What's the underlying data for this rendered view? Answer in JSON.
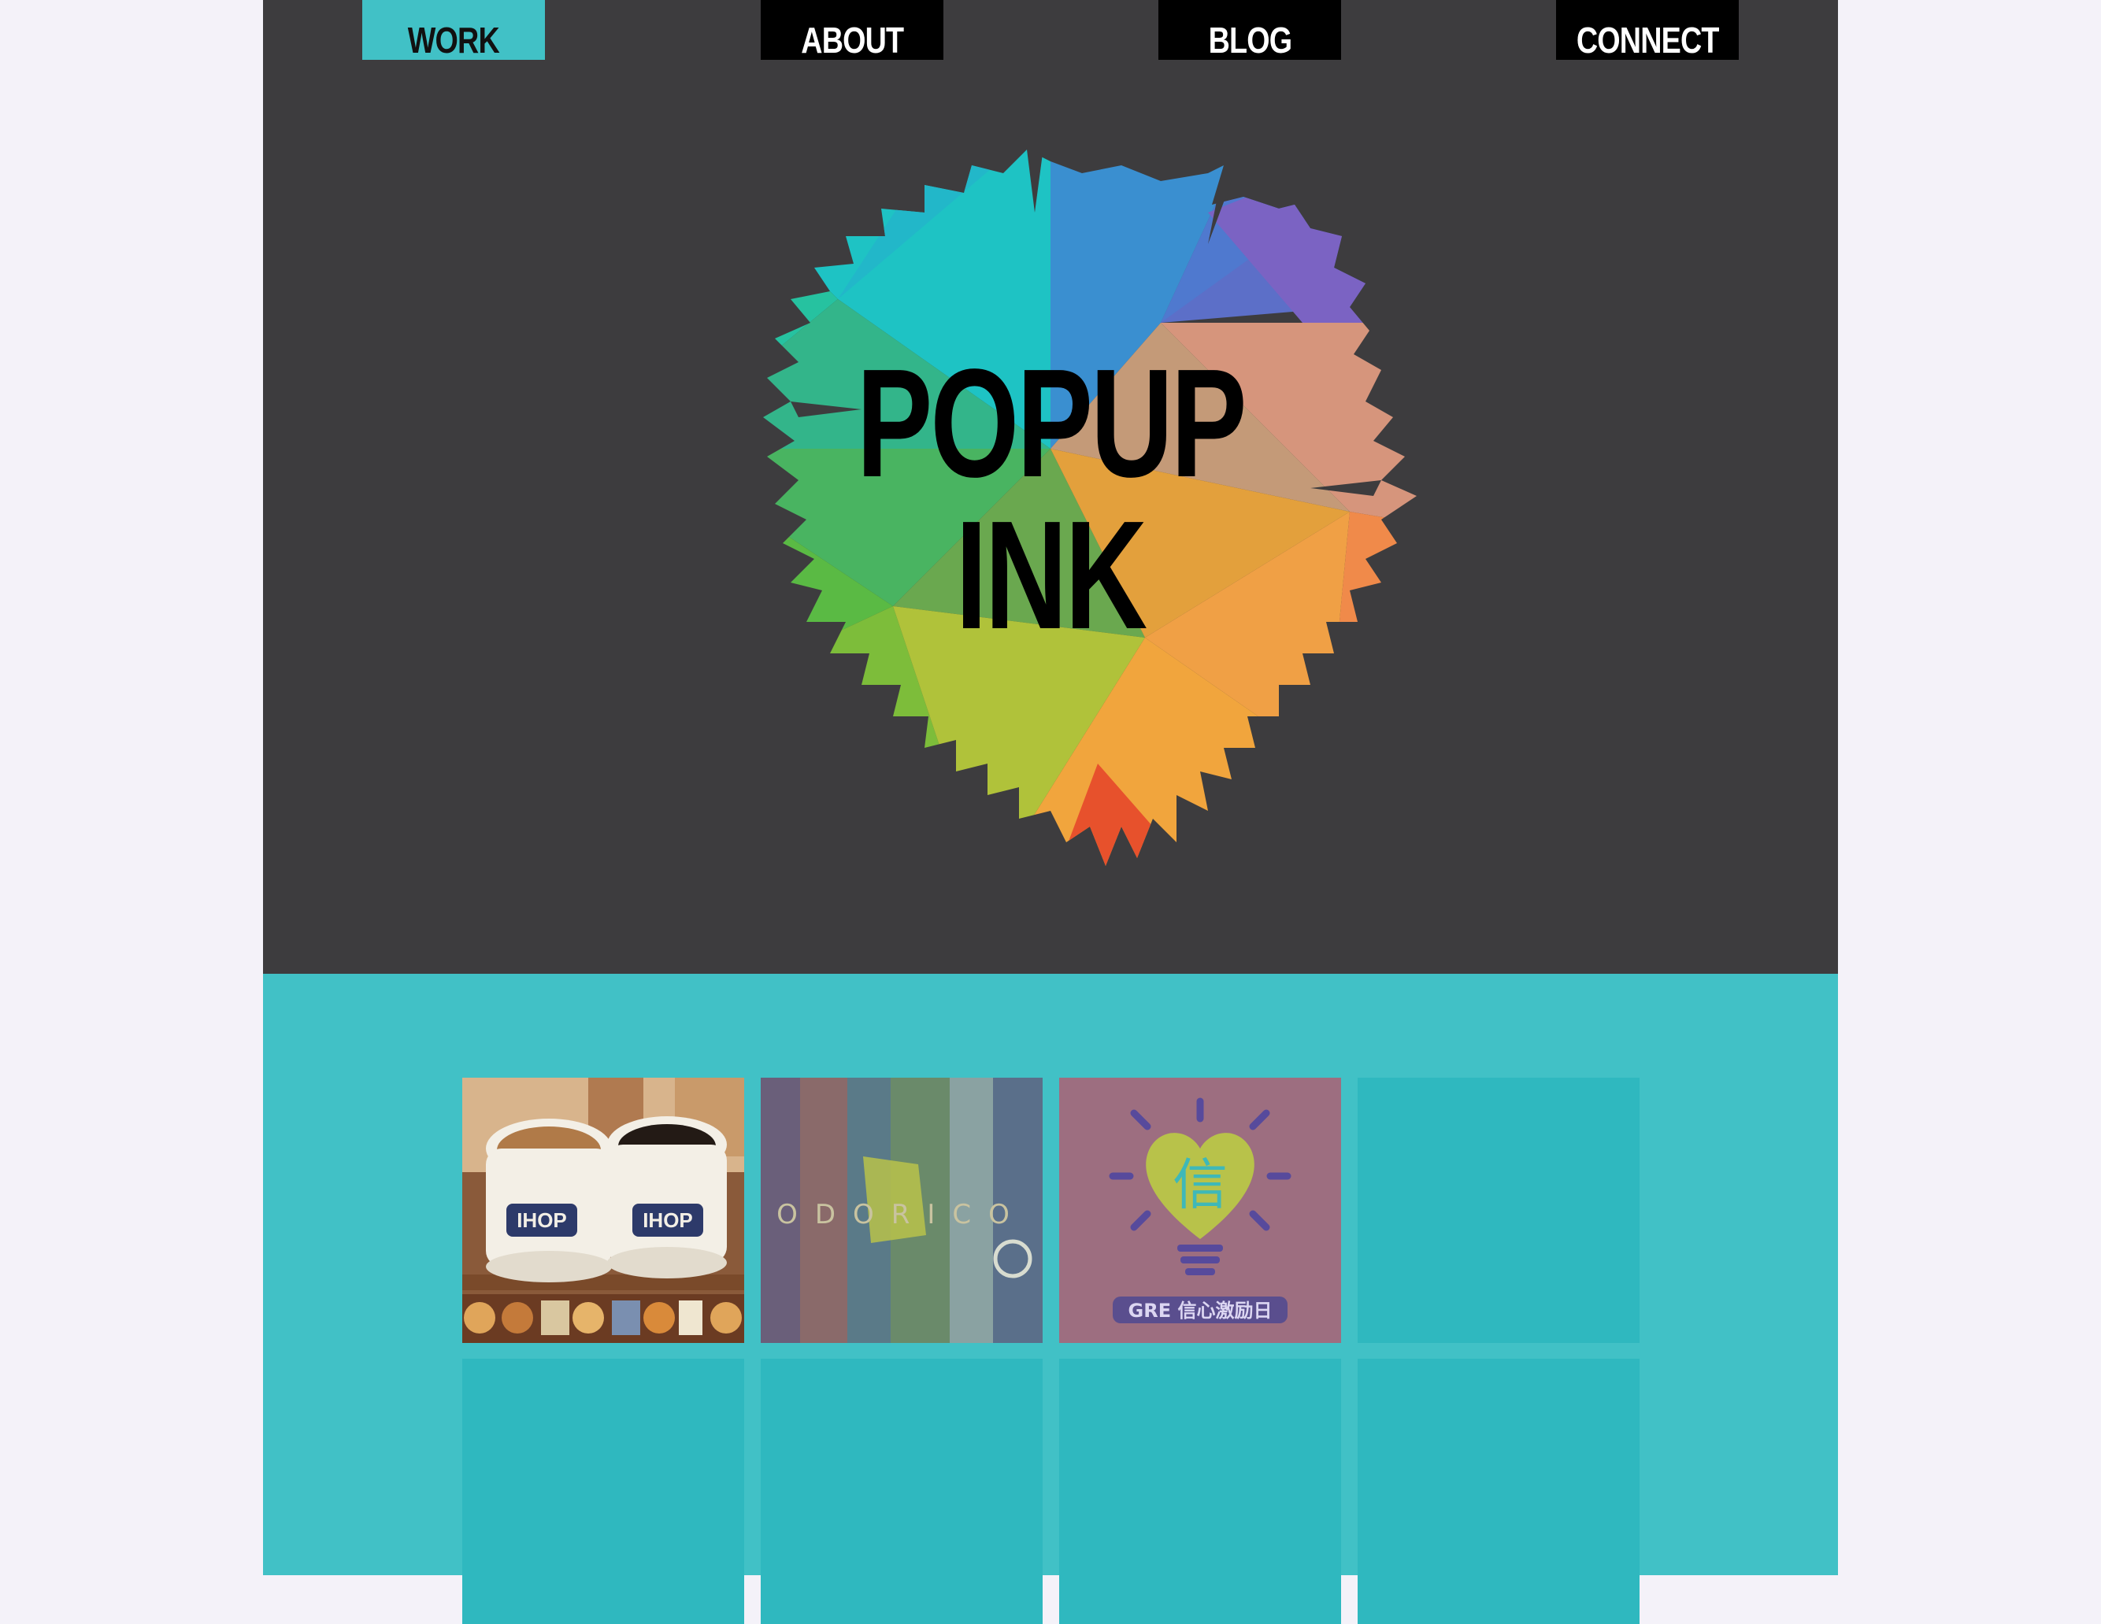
{
  "nav": {
    "items": [
      {
        "label": "WORK",
        "active": true
      },
      {
        "label": "ABOUT",
        "active": false
      },
      {
        "label": "BLOG",
        "active": false
      },
      {
        "label": "CONNECT",
        "active": false
      }
    ]
  },
  "logo": {
    "line1": "POPUP",
    "line2": "INK"
  },
  "gallery": {
    "tiles": [
      {
        "name": "ihop-coffee-mugs",
        "text": "IHOP"
      },
      {
        "name": "odorico-collage",
        "text": "ODORICO"
      },
      {
        "name": "gre-confidence-day",
        "caption": "GRE 信心激励日",
        "glyph": "信"
      },
      {
        "name": "empty-tile"
      },
      {
        "name": "empty-tile"
      },
      {
        "name": "empty-tile"
      },
      {
        "name": "empty-tile"
      },
      {
        "name": "empty-tile"
      }
    ]
  },
  "colors": {
    "page_bg": "#f4f2f9",
    "hero_bg": "#3d3c3e",
    "accent_teal": "#41c1c6",
    "tile_teal": "#2fb8bf",
    "nav_bg": "#000000"
  }
}
